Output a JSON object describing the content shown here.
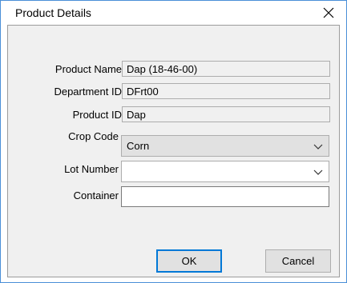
{
  "window": {
    "title": "Product Details"
  },
  "fields": {
    "product_name": {
      "label": "Product Name",
      "value": "Dap (18-46-00)"
    },
    "department_id": {
      "label": "Department ID",
      "value": "DFrt00"
    },
    "product_id": {
      "label": "Product ID",
      "value": "Dap"
    },
    "crop_code": {
      "label": "Crop Code",
      "value": "Corn"
    },
    "lot_number": {
      "label": "Lot Number",
      "value": ""
    },
    "container": {
      "label": "Container",
      "value": ""
    }
  },
  "buttons": {
    "ok": "OK",
    "cancel": "Cancel"
  },
  "icons": {
    "close": "close-icon",
    "dropdown": "chevron-down-icon"
  },
  "colors": {
    "window_border": "#4a8fd8",
    "client_bg": "#f0f0f0",
    "default_button_border": "#0078d7"
  }
}
